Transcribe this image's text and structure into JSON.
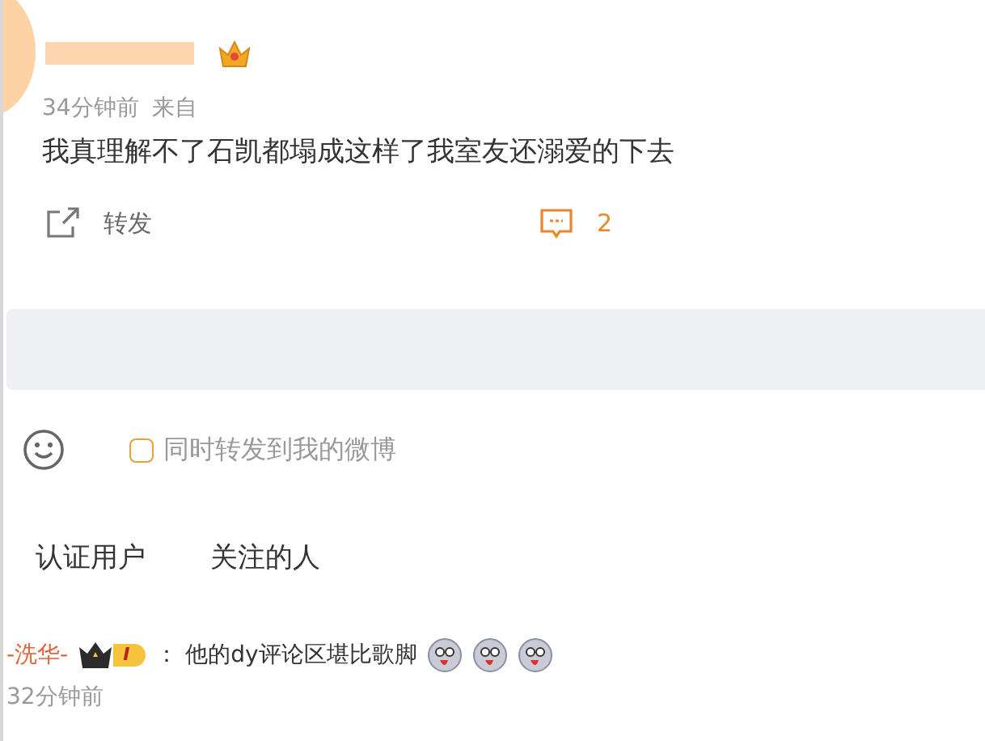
{
  "post": {
    "time": "34分钟前",
    "source_label": "来自",
    "text": "我真理解不了石凯都塌成这样了我室友还溺爱的下去",
    "actions": [
      {
        "kind": "repost",
        "label": "转发",
        "active": false
      },
      {
        "kind": "comment",
        "label": "2",
        "active": true
      }
    ]
  },
  "composer": {
    "repost_option": {
      "label": "同时转发到我的微博",
      "checked": false
    }
  },
  "filters": [
    {
      "label": "认证用户"
    },
    {
      "label": "关注的人"
    }
  ],
  "comments": [
    {
      "author": "-洗华-",
      "badge": "I",
      "separator": "：",
      "text": "他的dy评论区堪比歌脚",
      "time": "32分钟前"
    }
  ]
}
